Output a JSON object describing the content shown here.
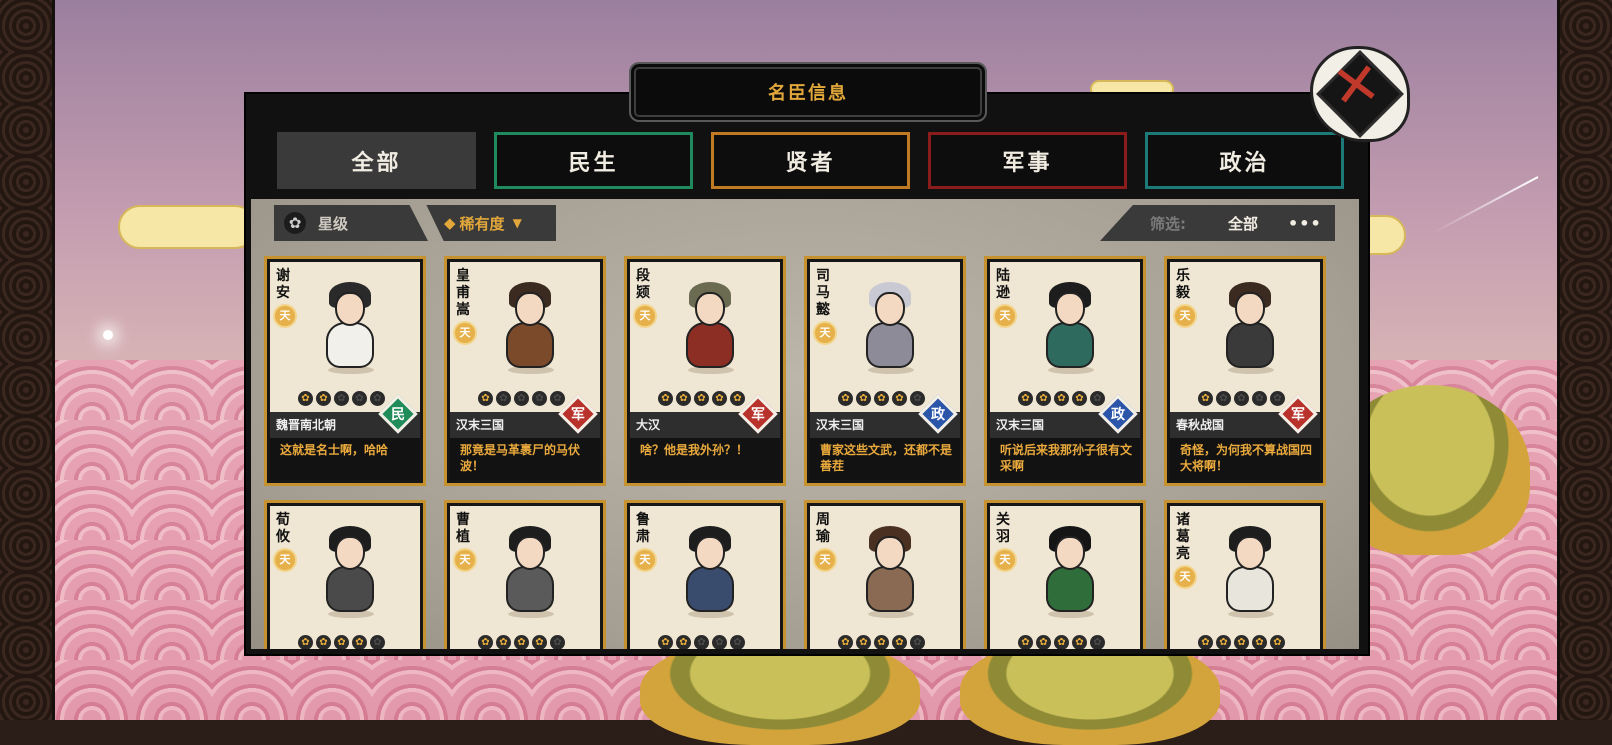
{
  "title": "名臣信息",
  "close_icon": "close-x-icon",
  "tabs": [
    {
      "label": "全部",
      "active": true
    },
    {
      "label": "民生",
      "color": "#1e8a5e"
    },
    {
      "label": "贤者",
      "color": "#c07a24"
    },
    {
      "label": "军事",
      "color": "#8a1c1c"
    },
    {
      "label": "政治",
      "color": "#1c7a78"
    }
  ],
  "sort": {
    "star_label": "星级",
    "star_icon": "flower-icon",
    "rarity_label": "稀有度",
    "rarity_icon": "diamond-icon"
  },
  "filter": {
    "label": "筛选:",
    "value": "全部",
    "more": "•••"
  },
  "rank_symbol": "天",
  "cards": [
    {
      "name": "谢安",
      "stars": 2,
      "era": "魏晋南北朝",
      "type": "民",
      "quote": "这就是名士啊，哈哈",
      "robe": "#f1f0ea",
      "hair": "#2a2a2a"
    },
    {
      "name": "皇甫嵩",
      "stars": 1,
      "era": "汉末三国",
      "type": "军",
      "quote": "那竟是马革裹尸的马伏波！",
      "robe": "#7a4a2a",
      "hair": "#3b2a20"
    },
    {
      "name": "段颎",
      "stars": 5,
      "era": "大汉",
      "type": "军",
      "quote": "啥？他是我外孙？！",
      "robe": "#8c2e24",
      "hair": "#6b6b52"
    },
    {
      "name": "司马懿",
      "stars": 4,
      "era": "汉末三国",
      "type": "政",
      "quote": "曹家这些文武，还都不是善茬",
      "robe": "#8d8b98",
      "hair": "#c9c9d3"
    },
    {
      "name": "陆逊",
      "stars": 4,
      "era": "汉末三国",
      "type": "政",
      "quote": "听说后来我那孙子很有文采啊",
      "robe": "#2f6a5f",
      "hair": "#1d1d1d"
    },
    {
      "name": "乐毅",
      "stars": 1,
      "era": "春秋战国",
      "type": "军",
      "quote": "奇怪，为何我不算战国四大将啊！",
      "robe": "#3a3a3a",
      "hair": "#3a2a20"
    },
    {
      "name": "荀攸",
      "stars": 4,
      "robe": "#4a4a4a",
      "hair": "#1d1d1d"
    },
    {
      "name": "曹植",
      "stars": 4,
      "robe": "#5a5a5a",
      "hair": "#1d1d1d"
    },
    {
      "name": "鲁肃",
      "stars": 2,
      "robe": "#3a4c6e",
      "hair": "#1d1d1d"
    },
    {
      "name": "周瑜",
      "stars": 4,
      "robe": "#8a6a52",
      "hair": "#4a3020"
    },
    {
      "name": "关羽",
      "stars": 4,
      "robe": "#2f6d3a",
      "hair": "#151515"
    },
    {
      "name": "诸葛亮",
      "stars": 5,
      "robe": "#e8e6dc",
      "hair": "#1d1d1d"
    }
  ]
}
